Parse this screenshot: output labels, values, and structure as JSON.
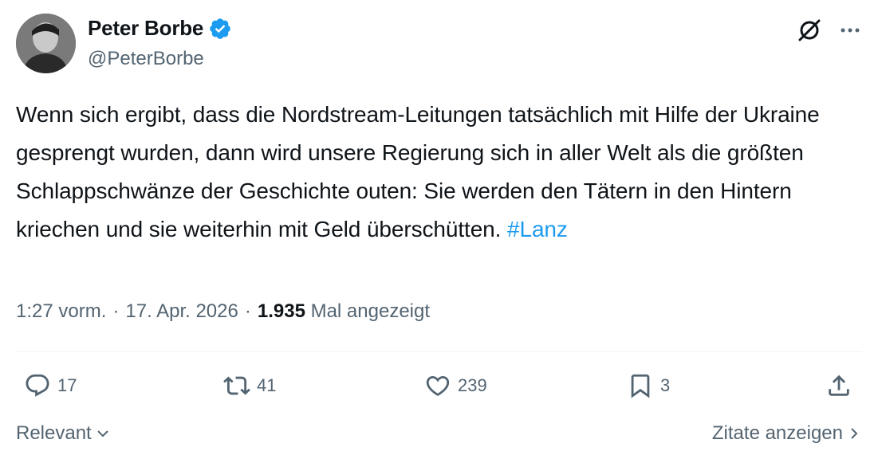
{
  "author": {
    "display_name": "Peter Borbe",
    "handle": "@PeterBorbe",
    "verified": true
  },
  "tweet": {
    "text": "Wenn sich ergibt, dass die Nordstream-Leitungen tatsächlich mit Hilfe der Ukraine gesprengt wurden, dann wird unsere Regierung sich in aller Welt als die größten Schlappschwänze der Geschichte outen: Sie werden den Tätern in den Hintern kriechen und sie weiterhin mit Geld überschütten.",
    "hashtag": "#Lanz"
  },
  "meta": {
    "time": "1:27 vorm.",
    "sep1": "·",
    "date": "17. Apr. 2026",
    "sep2": "·",
    "views_count": "1.935",
    "views_label": "Mal angezeigt"
  },
  "actions": {
    "replies": "17",
    "reposts": "41",
    "likes": "239",
    "bookmarks": "3"
  },
  "footer": {
    "sort_label": "Relevant",
    "quotes_label": "Zitate anzeigen"
  },
  "colors": {
    "text": "#0f1419",
    "secondary": "#536471",
    "accent": "#1d9bf0",
    "divider": "#eff3f4"
  },
  "icons": [
    "grok-icon",
    "more-icon",
    "verified-badge-icon",
    "reply-icon",
    "repost-icon",
    "like-icon",
    "bookmark-icon",
    "share-icon",
    "chevron-down-icon",
    "chevron-right-icon"
  ]
}
